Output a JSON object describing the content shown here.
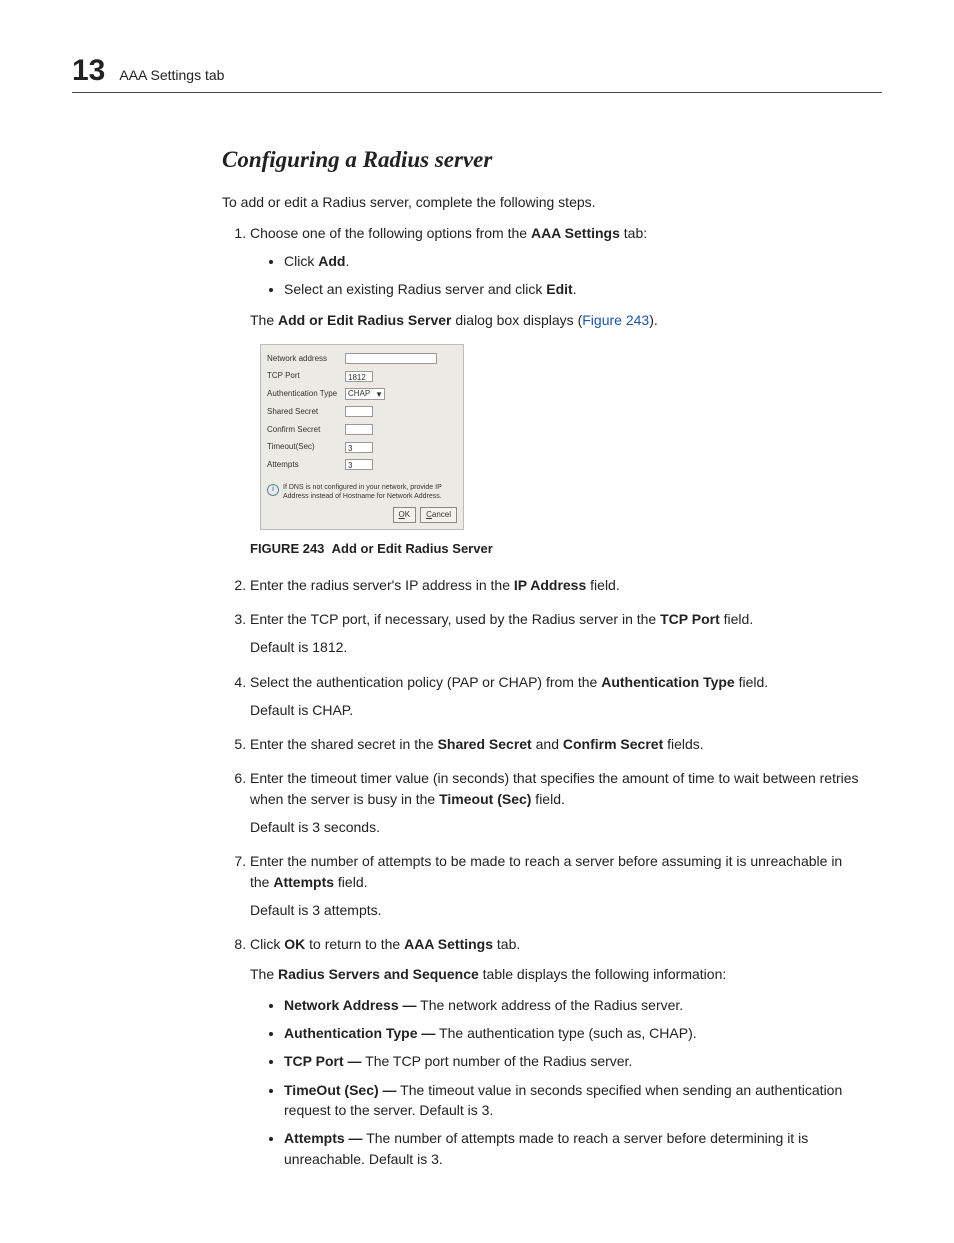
{
  "header": {
    "chapter_number": "13",
    "breadcrumb": "AAA Settings tab"
  },
  "section": {
    "title": "Configuring a Radius server",
    "intro": "To add or edit a Radius server, complete the following steps."
  },
  "steps": {
    "s1": {
      "text_a": "Choose one of the following options from the ",
      "bold_a": "AAA Settings",
      "text_b": " tab:",
      "b1_a": "Click ",
      "b1_bold": "Add",
      "b1_b": ".",
      "b2_a": "Select an existing Radius server and click ",
      "b2_bold": "Edit",
      "b2_b": ".",
      "note_a": "The ",
      "note_bold": "Add or Edit Radius Server",
      "note_b": " dialog box displays (",
      "note_link": "Figure 243",
      "note_c": ")."
    },
    "s2": {
      "a": "Enter the radius server's IP address in the ",
      "bold": "IP Address",
      "b": " field."
    },
    "s3": {
      "a": "Enter the TCP port, if necessary, used by the Radius server in the ",
      "bold": "TCP Port",
      "b": " field.",
      "default": "Default is 1812."
    },
    "s4": {
      "a": "Select the authentication policy (PAP or CHAP) from the ",
      "bold": "Authentication Type",
      "b": " field.",
      "default": "Default is CHAP."
    },
    "s5": {
      "a": "Enter the shared secret in the ",
      "bold1": "Shared Secret",
      "mid": " and ",
      "bold2": "Confirm Secret",
      "b": " fields."
    },
    "s6": {
      "a": "Enter the timeout timer value (in seconds) that specifies the amount of time to wait between retries when the server is busy in the ",
      "bold": "Timeout (Sec)",
      "b": " field.",
      "default": "Default is 3 seconds."
    },
    "s7": {
      "a": "Enter the number of attempts to be made to reach a server before assuming it is unreachable in the ",
      "bold": "Attempts",
      "b": " field.",
      "default": "Default is 3 attempts."
    },
    "s8": {
      "a": "Click ",
      "bold1": "OK",
      "b": " to return to the ",
      "bold2": "AAA Settings",
      "c": " tab.",
      "note_a": "The ",
      "note_bold": "Radius Servers and Sequence",
      "note_b": " table displays the following information:",
      "tbl": {
        "i1_bold": "Network Address —",
        "i1": " The network address of the Radius server.",
        "i2_bold": "Authentication Type —",
        "i2": " The authentication type (such as, CHAP).",
        "i3_bold": "TCP Port —",
        "i3": " The TCP port number of the Radius server.",
        "i4_bold": "TimeOut (Sec) —",
        "i4": " The timeout value in seconds specified when sending an authentication request to the server. Default is 3.",
        "i5_bold": "Attempts —",
        "i5": " The number of attempts made to reach a server before determining it is unreachable. Default is 3."
      }
    }
  },
  "dialog": {
    "fields": {
      "network_address": "Network address",
      "tcp_port": "TCP Port",
      "tcp_port_value": "1812",
      "auth_type": "Authentication Type",
      "auth_type_value": "CHAP",
      "shared_secret": "Shared Secret",
      "confirm_secret": "Confirm Secret",
      "timeout": "Timeout(Sec)",
      "timeout_value": "3",
      "attempts": "Attempts",
      "attempts_value": "3"
    },
    "info": "If DNS is not configured in your network, provide IP Address instead of Hostname for Network Address.",
    "ok": "OK",
    "cancel": "Cancel"
  },
  "figure": {
    "label": "FIGURE 243",
    "caption": "Add or Edit Radius Server"
  }
}
